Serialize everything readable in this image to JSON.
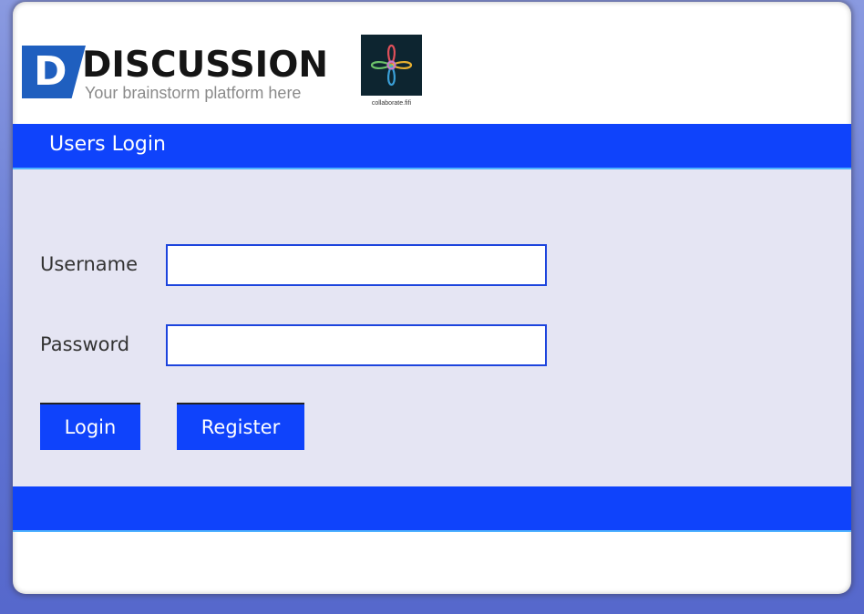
{
  "logo": {
    "letter": "D",
    "title": "DISCUSSION",
    "tagline": "Your brainstorm platform here",
    "collab_caption": "collaborate.fifi",
    "collab_icon": "four-loop-knot-icon"
  },
  "header": {
    "title": "Users Login"
  },
  "form": {
    "username_label": "Username",
    "username_value": "",
    "password_label": "Password",
    "password_value": ""
  },
  "buttons": {
    "login": "Login",
    "register": "Register"
  },
  "colors": {
    "accent_blue": "#0f43fb",
    "form_background": "#e5e5f3",
    "input_border": "#1c44dd"
  }
}
